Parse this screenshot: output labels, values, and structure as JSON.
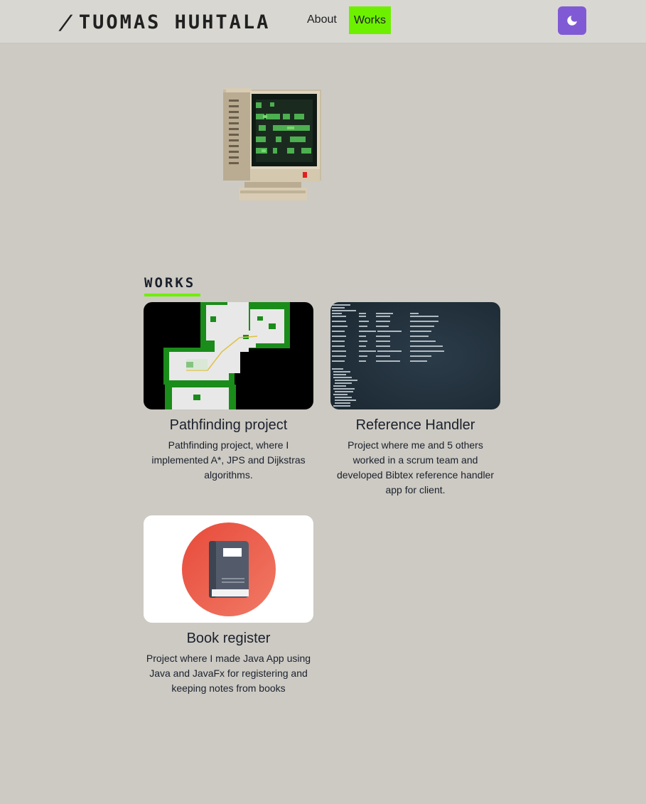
{
  "navbar": {
    "brand_slash": "/",
    "brand_name": "TUOMAS HUHTALA",
    "links": [
      {
        "label": "About"
      },
      {
        "label": "Works",
        "active": true
      }
    ],
    "theme_toggle_icon": "moon-icon",
    "accent_color": "#6df000",
    "toggle_color": "#805ad5"
  },
  "hero": {
    "image": "pixel-computer-illustration"
  },
  "works": {
    "title": "WORKS",
    "items": [
      {
        "title": "Pathfinding project",
        "description": "Pathfinding project, where I implemented A*, JPS and Dijkstras algorithms.",
        "thumbnail": "pathfinding-map-thumbnail"
      },
      {
        "title": "Reference Handler",
        "description": "Project where me and 5 others worked in a scrum team and developed Bibtex reference handler app for client.",
        "thumbnail": "terminal-screenshot-thumbnail"
      },
      {
        "title": "Book register",
        "description": "Project where I made Java App using Java and JavaFx for registering and keeping notes from books",
        "thumbnail": "book-icon-thumbnail"
      }
    ]
  },
  "colors": {
    "page_background": "#cdcac3",
    "navbar_background": "#d9d7d2"
  }
}
